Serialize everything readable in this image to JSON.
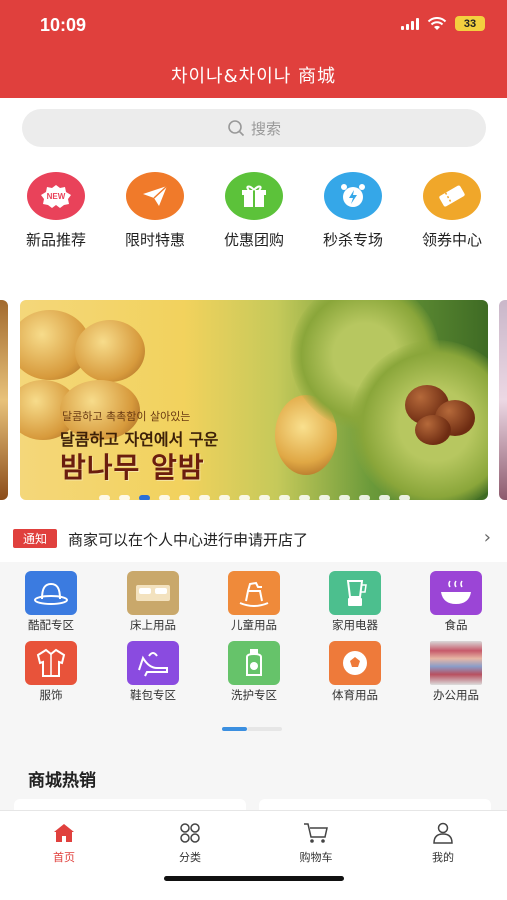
{
  "status_bar": {
    "time": "10:09",
    "battery": "33"
  },
  "header": {
    "title": "차이나&차이나 商城"
  },
  "search": {
    "placeholder": "搜索"
  },
  "quick_menu": [
    {
      "label": "新品推荐",
      "icon": "new-badge-icon",
      "color": "#e9425a"
    },
    {
      "label": "限时特惠",
      "icon": "paper-plane-icon",
      "color": "#f07a2a"
    },
    {
      "label": "优惠团购",
      "icon": "gift-icon",
      "color": "#5cc23a"
    },
    {
      "label": "秒杀专场",
      "icon": "alarm-clock-icon",
      "color": "#35a7e8"
    },
    {
      "label": "领券中心",
      "icon": "coupon-icon",
      "color": "#f0a72a"
    }
  ],
  "banner": {
    "line_small": "달콤하고 촉촉함이 살아있는",
    "line_mid": "달콤하고 자연에서 구운",
    "line_big": "밤나무 알밤",
    "slide_count": 16,
    "active_slide": 3
  },
  "notice": {
    "badge": "通知",
    "text": "商家可以在个人中心进行申请开店了"
  },
  "categories": [
    {
      "label": "酷配专区",
      "icon": "hat-icon",
      "color": "#3b7be0"
    },
    {
      "label": "床上用品",
      "icon": "bed-icon",
      "color": "#c9a86b"
    },
    {
      "label": "儿童用品",
      "icon": "rocking-horse-icon",
      "color": "#ef8a3a"
    },
    {
      "label": "家用电器",
      "icon": "blender-icon",
      "color": "#4cbf8e"
    },
    {
      "label": "食品",
      "icon": "noodle-bowl-icon",
      "color": "#9b45d6"
    },
    {
      "label": "服饰",
      "icon": "jacket-icon",
      "color": "#e8533a"
    },
    {
      "label": "鞋包专区",
      "icon": "high-heel-icon",
      "color": "#8a4be0"
    },
    {
      "label": "洗护专区",
      "icon": "lotion-bottle-icon",
      "color": "#66c36a"
    },
    {
      "label": "体育用品",
      "icon": "soccer-ball-icon",
      "color": "#ee7a3a"
    },
    {
      "label": "办公用品",
      "icon": "towels-photo-icon",
      "color": "#b85060"
    }
  ],
  "hot_section": {
    "title": "商城热销"
  },
  "tabbar": [
    {
      "label": "首页",
      "icon": "home-icon",
      "active": true
    },
    {
      "label": "分类",
      "icon": "grid-circles-icon",
      "active": false
    },
    {
      "label": "购物车",
      "icon": "cart-icon",
      "active": false
    },
    {
      "label": "我的",
      "icon": "person-icon",
      "active": false
    }
  ],
  "colors": {
    "brand_red": "#e0403d",
    "pager_active": "#2b6fd6"
  }
}
